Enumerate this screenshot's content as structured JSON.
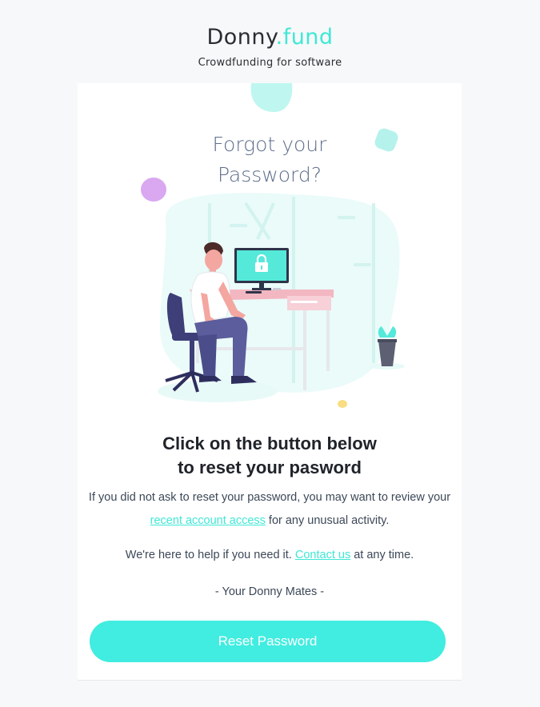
{
  "header": {
    "brand_main": "Donny",
    "brand_accent": ".fund",
    "tagline": "Crowdfunding for software"
  },
  "illustration": {
    "title_line1": "Forgot your",
    "title_line2": "Password?",
    "icons": [
      "lock-icon",
      "person-at-desk",
      "potted-plant"
    ]
  },
  "content": {
    "headline_line1": "Click on the button below",
    "headline_line2": "to reset your pasword",
    "para1_before": "If you did not ask to reset your password, you may want to review your ",
    "para1_link": "recent account access",
    "para1_after": " for any unusual activity.",
    "para2_before": "We're here to help if you need it. ",
    "para2_link": "Contact us",
    "para2_after": " at any time.",
    "signoff": "- Your Donny Mates -",
    "button_label": "Reset Password"
  },
  "colors": {
    "accent": "#3fe8d6",
    "button": "#40ede0",
    "headline": "#20232a",
    "title": "#5e6e8c",
    "desk": "#f3b7c2"
  }
}
